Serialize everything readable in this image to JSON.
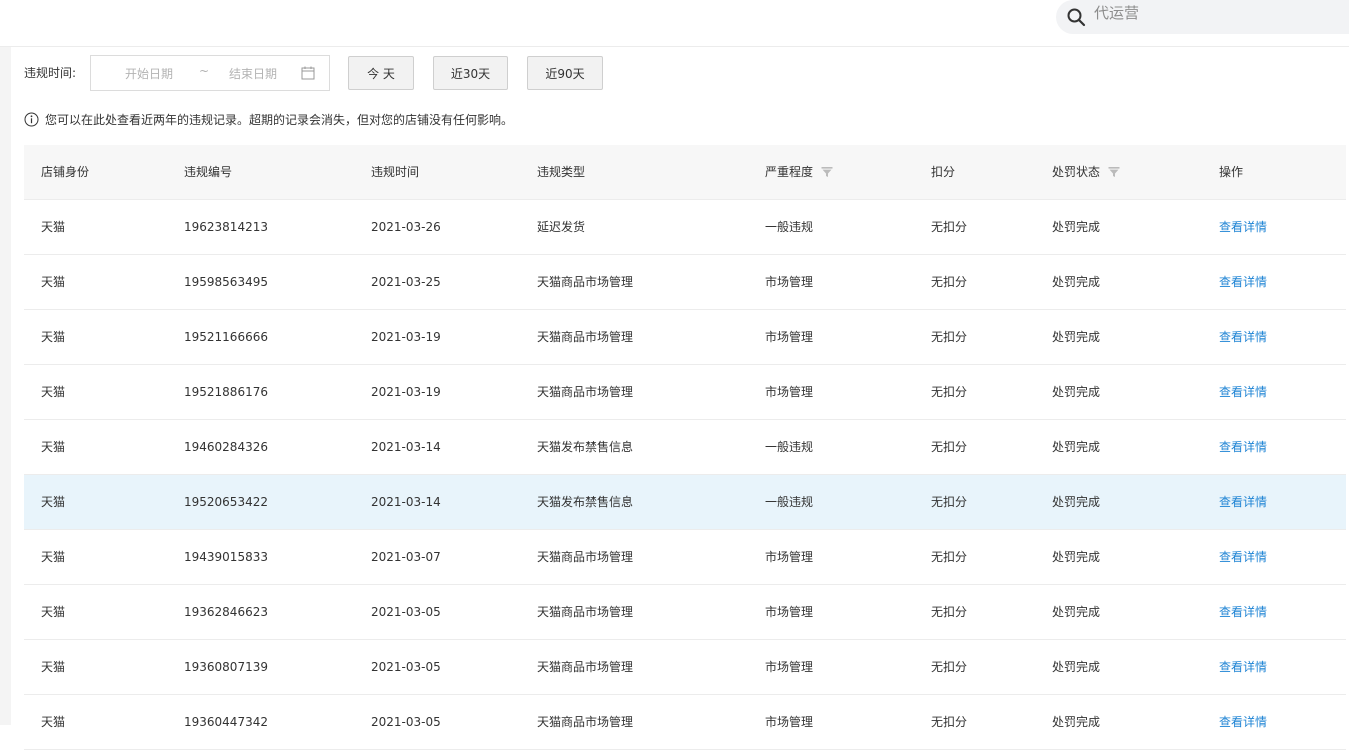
{
  "search": {
    "placeholder": "代运营"
  },
  "filter": {
    "label": "违规时间:",
    "start_placeholder": "开始日期",
    "separator": "~",
    "end_placeholder": "结束日期",
    "buttons": {
      "today": "今 天",
      "last30": "近30天",
      "last90": "近90天"
    }
  },
  "notice": "您可以在此处查看近两年的违规记录。超期的记录会消失，但对您的店铺没有任何影响。",
  "table": {
    "headers": [
      "店铺身份",
      "违规编号",
      "违规时间",
      "违规类型",
      "严重程度",
      "扣分",
      "处罚状态",
      "操作"
    ],
    "rows": [
      {
        "shop": "天猫",
        "id": "19623814213",
        "date": "2021-03-26",
        "type": "延迟发货",
        "severity": "一般违规",
        "points": "无扣分",
        "status": "处罚完成",
        "action": "查看详情"
      },
      {
        "shop": "天猫",
        "id": "19598563495",
        "date": "2021-03-25",
        "type": "天猫商品市场管理",
        "severity": "市场管理",
        "points": "无扣分",
        "status": "处罚完成",
        "action": "查看详情"
      },
      {
        "shop": "天猫",
        "id": "19521166666",
        "date": "2021-03-19",
        "type": "天猫商品市场管理",
        "severity": "市场管理",
        "points": "无扣分",
        "status": "处罚完成",
        "action": "查看详情"
      },
      {
        "shop": "天猫",
        "id": "19521886176",
        "date": "2021-03-19",
        "type": "天猫商品市场管理",
        "severity": "市场管理",
        "points": "无扣分",
        "status": "处罚完成",
        "action": "查看详情"
      },
      {
        "shop": "天猫",
        "id": "19460284326",
        "date": "2021-03-14",
        "type": "天猫发布禁售信息",
        "severity": "一般违规",
        "points": "无扣分",
        "status": "处罚完成",
        "action": "查看详情"
      },
      {
        "shop": "天猫",
        "id": "19520653422",
        "date": "2021-03-14",
        "type": "天猫发布禁售信息",
        "severity": "一般违规",
        "points": "无扣分",
        "status": "处罚完成",
        "action": "查看详情"
      },
      {
        "shop": "天猫",
        "id": "19439015833",
        "date": "2021-03-07",
        "type": "天猫商品市场管理",
        "severity": "市场管理",
        "points": "无扣分",
        "status": "处罚完成",
        "action": "查看详情"
      },
      {
        "shop": "天猫",
        "id": "19362846623",
        "date": "2021-03-05",
        "type": "天猫商品市场管理",
        "severity": "市场管理",
        "points": "无扣分",
        "status": "处罚完成",
        "action": "查看详情"
      },
      {
        "shop": "天猫",
        "id": "19360807139",
        "date": "2021-03-05",
        "type": "天猫商品市场管理",
        "severity": "市场管理",
        "points": "无扣分",
        "status": "处罚完成",
        "action": "查看详情"
      },
      {
        "shop": "天猫",
        "id": "19360447342",
        "date": "2021-03-05",
        "type": "天猫商品市场管理",
        "severity": "市场管理",
        "points": "无扣分",
        "status": "处罚完成",
        "action": "查看详情"
      }
    ]
  },
  "colors": {
    "link": "#1f84d4",
    "highlight_row": "#e8f4fb",
    "header_bg": "#f7f7f7"
  },
  "icons": {
    "search": "search-icon",
    "calendar": "calendar-icon",
    "info": "info-icon",
    "filter": "filter-icon"
  }
}
